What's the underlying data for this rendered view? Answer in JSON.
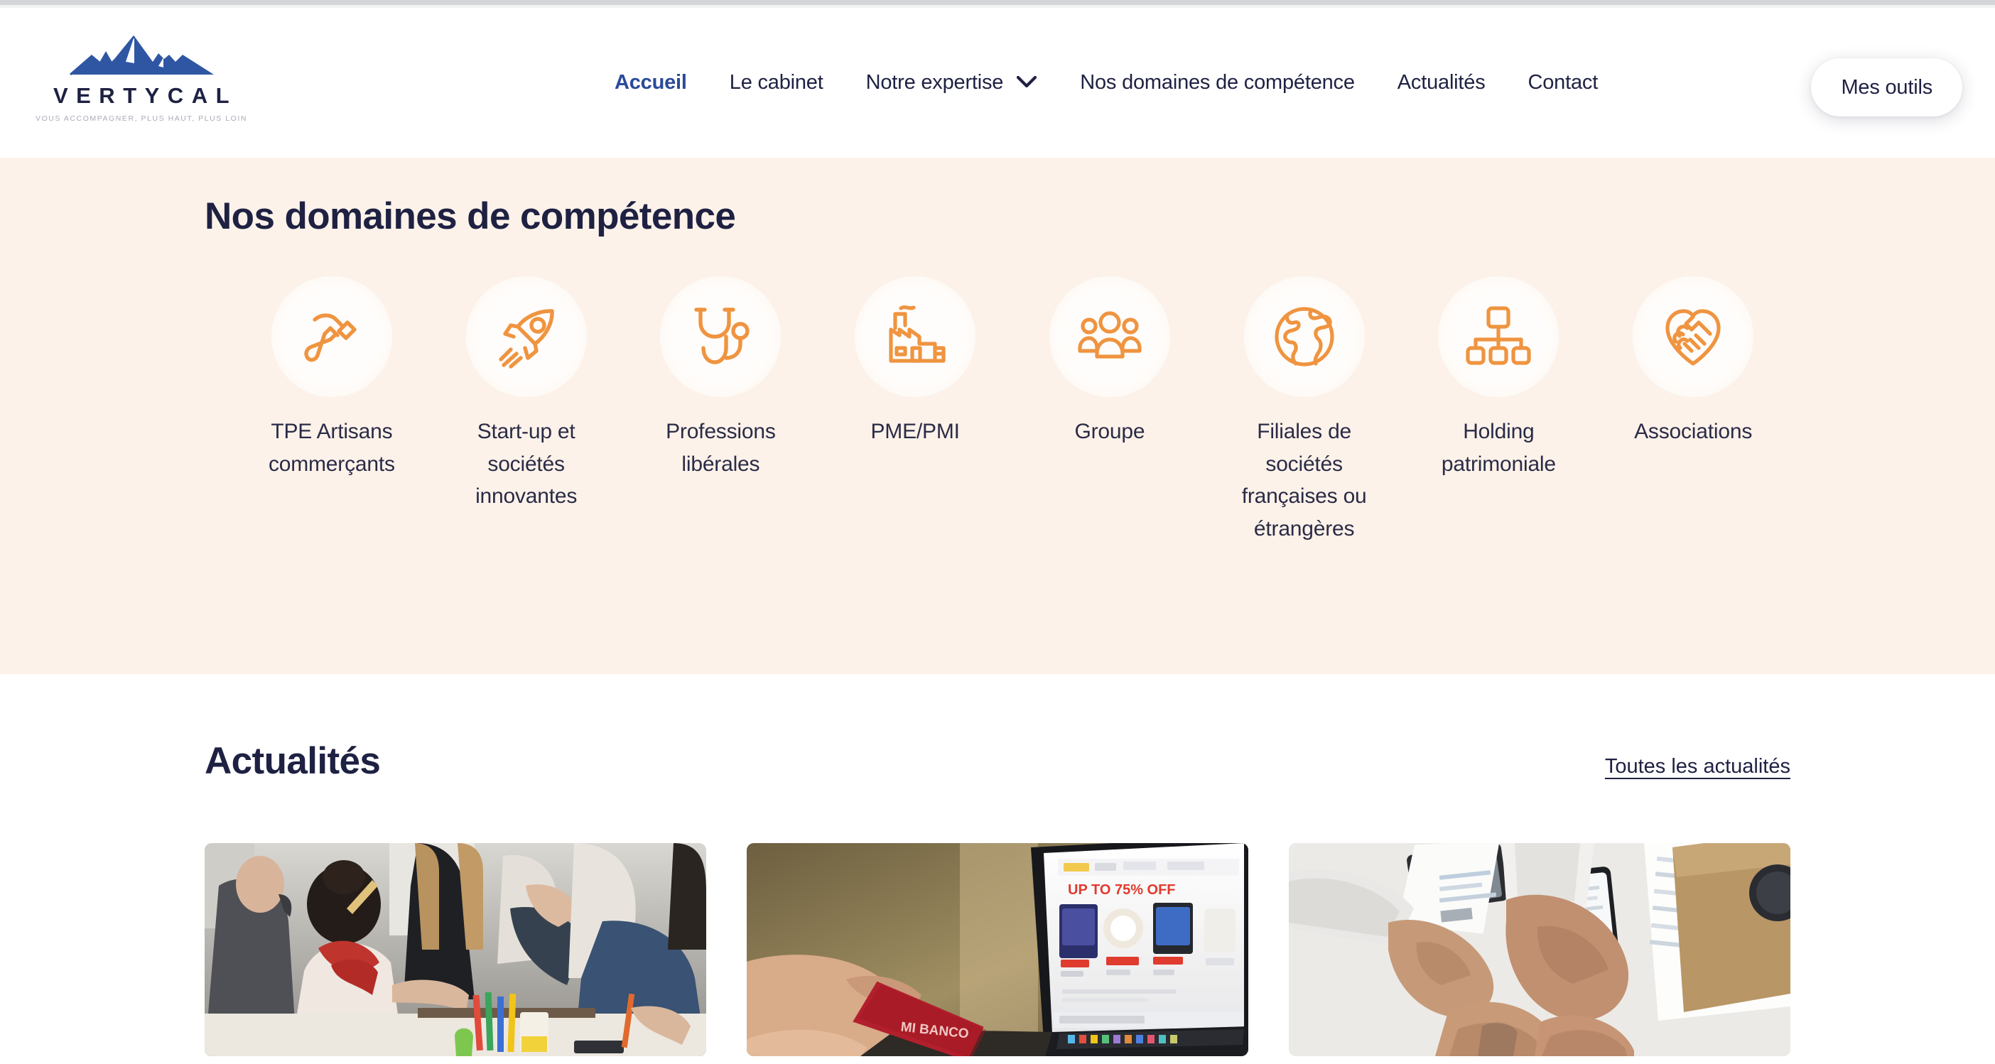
{
  "brand": {
    "name": "VERTYCAL",
    "tagline": "VOUS ACCOMPAGNER, PLUS HAUT, PLUS LOIN",
    "logo_icon": "mountain-peaks-icon",
    "logo_color": "#2f56a3",
    "wordmark_color": "#1e2142"
  },
  "colors": {
    "accent_orange": "#ef9440",
    "navy": "#1e2142",
    "text_navy": "#2a2b47",
    "active_blue": "#2a4a9b",
    "cream_bg": "#fdf2e9",
    "white": "#ffffff"
  },
  "nav": {
    "items": [
      {
        "label": "Accueil",
        "active": true,
        "has_dropdown": false
      },
      {
        "label": "Le cabinet",
        "active": false,
        "has_dropdown": false
      },
      {
        "label": "Notre expertise",
        "active": false,
        "has_dropdown": true
      },
      {
        "label": "Nos domaines de compétence",
        "active": false,
        "has_dropdown": false
      },
      {
        "label": "Actualités",
        "active": false,
        "has_dropdown": false
      },
      {
        "label": "Contact",
        "active": false,
        "has_dropdown": false
      }
    ],
    "cta_label": "Mes outils"
  },
  "competence": {
    "title": "Nos domaines de compétence",
    "items": [
      {
        "label": "TPE Artisans commerçants",
        "icon": "hammer-icon"
      },
      {
        "label": "Start-up et sociétés innovantes",
        "icon": "rocket-icon"
      },
      {
        "label": "Professions libérales",
        "icon": "stethoscope-icon"
      },
      {
        "label": "PME/PMI",
        "icon": "factory-icon"
      },
      {
        "label": "Groupe",
        "icon": "people-group-icon"
      },
      {
        "label": "Filiales de sociétés françaises ou étrangères",
        "icon": "globe-icon"
      },
      {
        "label": "Holding patrimoniale",
        "icon": "org-chart-icon"
      },
      {
        "label": "Associations",
        "icon": "heart-handshake-icon"
      }
    ]
  },
  "news": {
    "title": "Actualités",
    "all_link_label": "Toutes les actualités",
    "cards": [
      {
        "image_alt": "Équipe en atelier collaboratif autour d'une table",
        "image_name": "team-workshop-photo"
      },
      {
        "image_alt": "Main tenant une carte bancaire rouge devant un ordinateur portable en e-commerce",
        "image_name": "online-payment-photo"
      },
      {
        "image_alt": "Trois poings qui se rejoignent au-dessus d'un bureau avec documents",
        "image_name": "fist-bump-teamwork-photo"
      }
    ]
  }
}
